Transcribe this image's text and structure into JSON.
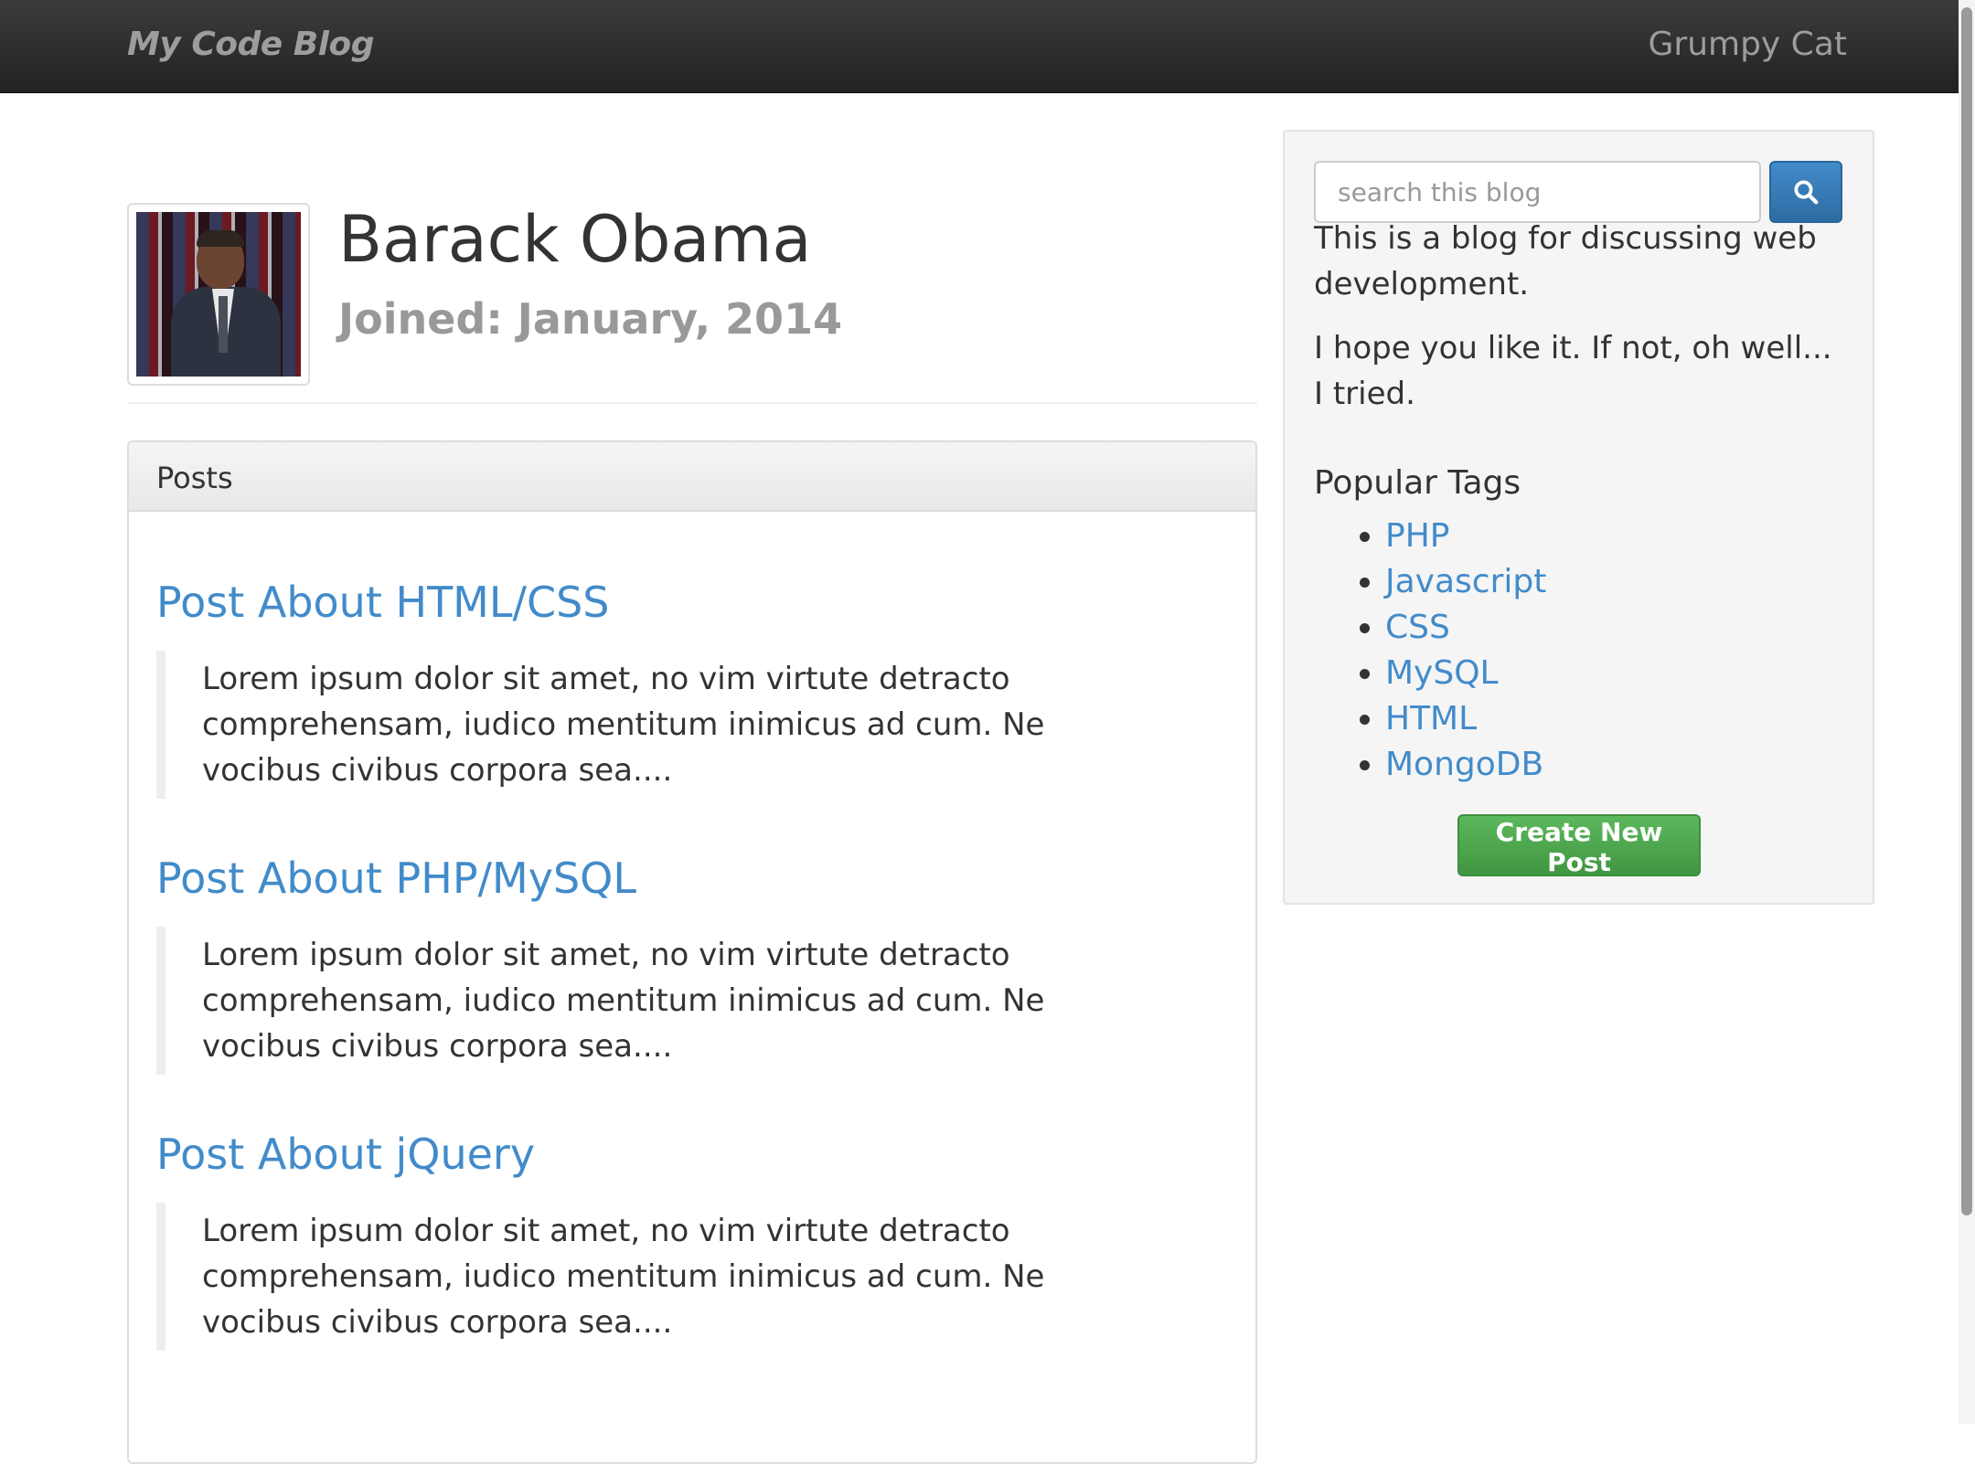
{
  "navbar": {
    "brand": "My Code Blog",
    "user": "Grumpy Cat"
  },
  "profile": {
    "name": "Barack Obama",
    "joined": "Joined: January, 2014"
  },
  "posts_panel": {
    "heading": "Posts",
    "posts": [
      {
        "title": "Post About HTML/CSS",
        "excerpt": "Lorem ipsum dolor sit amet, no vim virtute detracto comprehensam, iudico mentitum inimicus ad cum. Ne vocibus civibus corpora sea...."
      },
      {
        "title": "Post About PHP/MySQL",
        "excerpt": "Lorem ipsum dolor sit amet, no vim virtute detracto comprehensam, iudico mentitum inimicus ad cum. Ne vocibus civibus corpora sea...."
      },
      {
        "title": "Post About jQuery",
        "excerpt": "Lorem ipsum dolor sit amet, no vim virtute detracto comprehensam, iudico mentitum inimicus ad cum. Ne vocibus civibus corpora sea...."
      }
    ]
  },
  "sidebar": {
    "search_placeholder": "search this blog",
    "search_icon": "search-icon",
    "description_1": "This is a blog for discussing web development.",
    "description_2": "I hope you like it. If not, oh well... I tried.",
    "tags_heading": "Popular Tags",
    "tags": [
      "PHP",
      "Javascript",
      "CSS",
      "MySQL",
      "HTML",
      "MongoDB"
    ],
    "create_button": "Create New Post"
  },
  "colors": {
    "navbar": "#222222",
    "link": "#428bca",
    "primary_button": "#428bca",
    "success_button": "#5cb85c"
  }
}
